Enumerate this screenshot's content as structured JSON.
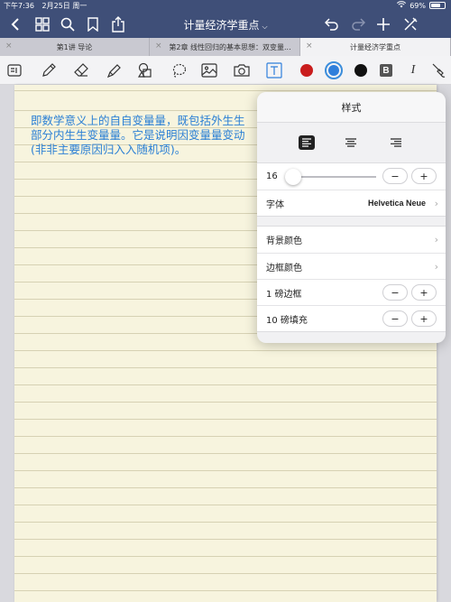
{
  "status": {
    "time": "下午7:36",
    "date": "2月25日 周一",
    "battery": "69%",
    "battery_level": 0.69
  },
  "nav": {
    "title": "计量经济学重点",
    "icons": [
      "back-icon",
      "grid-icon",
      "search-icon",
      "bookmark-icon",
      "share-icon",
      "undo-icon",
      "redo-icon",
      "add-icon",
      "close-edit-icon"
    ]
  },
  "tabs": [
    {
      "label": "第1讲 导论"
    },
    {
      "label": "第2章 线性回归的基本思想：双变量..."
    },
    {
      "label": "计量经济学重点"
    }
  ],
  "toolbar": {
    "colors": {
      "red": "#c91d1d",
      "blue": "#2f7fdb",
      "black": "#111111"
    },
    "bold_label": "B",
    "italic_label": "I",
    "text_tool_label": "T"
  },
  "note": {
    "line1": "即数学意义上的自自变量量，既包括外生生",
    "line2": "部分内生生变量量。它是说明因变量量变动",
    "line3": "(非非主要原因归入入随机项)。",
    "color": "#2a7fd4"
  },
  "style_panel": {
    "title": "样式",
    "font_size": "16",
    "font_size_slider_level": 0.05,
    "font_label": "字体",
    "font_value": "Helvetica Neue",
    "bg_color_label": "背景颜色",
    "border_color_label": "边框颜色",
    "border_width_label": "1 磅边框",
    "padding_label": "10 磅填充",
    "minus": "−",
    "plus": "+"
  }
}
